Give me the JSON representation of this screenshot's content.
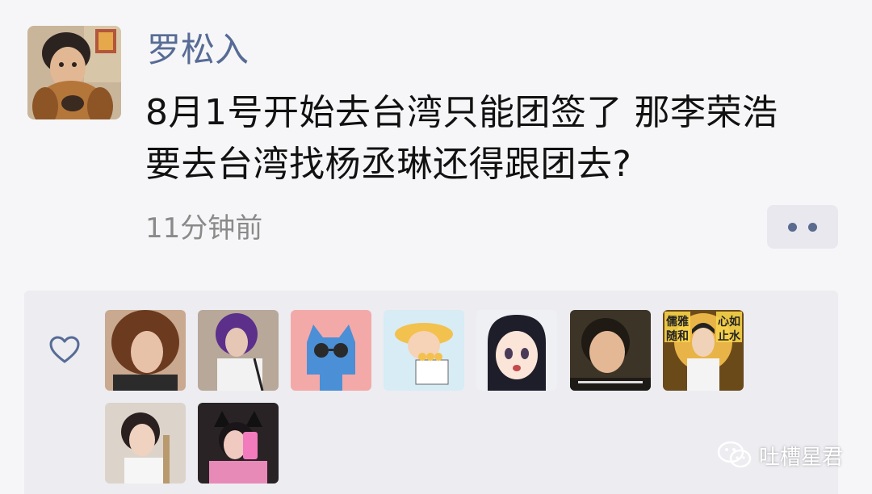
{
  "post": {
    "author": "罗松入",
    "text_line1": "8月1号开始去台湾只能团签了 那李荣浩",
    "text_line2": "要去台湾找杨丞琳还得跟团去?",
    "time": "11分钟前"
  },
  "icons": {
    "more": "more-dots-icon",
    "like": "heart-icon",
    "watermark": "wechat-logo-icon"
  },
  "likes": {
    "avatars": [
      "liker-1",
      "liker-2",
      "liker-3",
      "liker-4",
      "liker-5",
      "liker-6",
      "liker-7",
      "liker-8",
      "liker-9"
    ],
    "meme_texts": [
      "儒雅",
      "随和",
      "心如",
      "止水"
    ]
  },
  "watermark": {
    "label": "吐槽星君"
  },
  "colors": {
    "author_name": "#576b95",
    "background": "#f6f6f8",
    "likes_panel": "#ececf1"
  }
}
